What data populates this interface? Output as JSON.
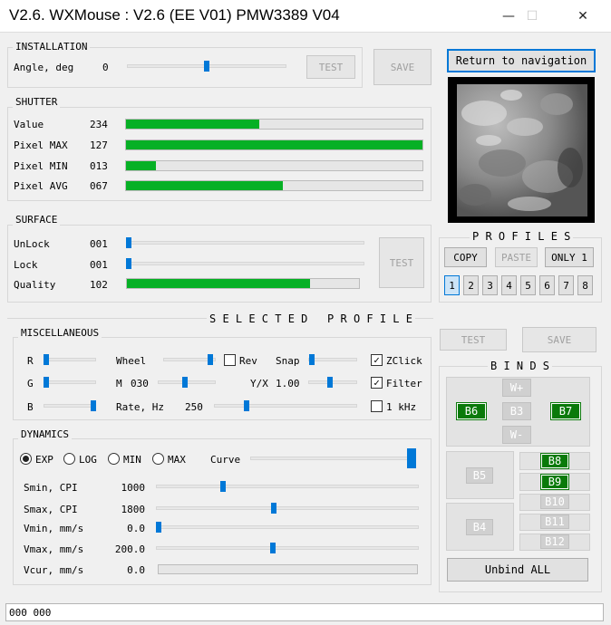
{
  "window": {
    "title": "V2.6. WXMouse : V2.6 (EE V01) PMW3389 V04",
    "minimize_glyph": "—",
    "maximize_glyph": "☐",
    "close_glyph": "✕"
  },
  "installation": {
    "title": "INSTALLATION",
    "angle_label": "Angle, deg",
    "angle_value": "0",
    "test_label": "TEST",
    "save_label": "SAVE"
  },
  "nav": {
    "return_label": "Return to navigation"
  },
  "shutter": {
    "title": "SHUTTER",
    "rows": [
      {
        "label": "Value",
        "value": "234",
        "fill": 0.45
      },
      {
        "label": "Pixel MAX",
        "value": "127",
        "fill": 1.0
      },
      {
        "label": "Pixel MIN",
        "value": "013",
        "fill": 0.1
      },
      {
        "label": "Pixel AVG",
        "value": "067",
        "fill": 0.53
      }
    ]
  },
  "surface": {
    "title": "SURFACE",
    "unlock_label": "UnLock",
    "unlock_value": "001",
    "lock_label": "Lock",
    "lock_value": "001",
    "quality_label": "Quality",
    "quality_value": "102",
    "quality_fill": 0.79,
    "test_label": "TEST"
  },
  "profiles": {
    "title": "P R O F I L E S",
    "copy_label": "COPY",
    "paste_label": "PASTE",
    "only1_label": "ONLY 1",
    "numbers": [
      "1",
      "2",
      "3",
      "4",
      "5",
      "6",
      "7",
      "8"
    ],
    "selected": "1"
  },
  "selected_profile": {
    "title": "S E L E C T E D   P R O F I L E",
    "test_label": "TEST",
    "save_label": "SAVE"
  },
  "misc": {
    "title": "MISCELLANEOUS",
    "r_label": "R",
    "g_label": "G",
    "b_label": "B",
    "wheel_label": "Wheel",
    "rev_label": "Rev",
    "snap_label": "Snap",
    "zclick_label": "ZClick",
    "m_label": "M",
    "m_value": "030",
    "yx_label": "Y/X",
    "yx_value": "1.00",
    "filter_label": "Filter",
    "rate_label": "Rate, Hz",
    "rate_value": "250",
    "khz_label": "1 kHz",
    "check_glyph": "✓"
  },
  "dynamics": {
    "title": "DYNAMICS",
    "modes": [
      "EXP",
      "LOG",
      "MIN",
      "MAX"
    ],
    "selected_mode": "EXP",
    "curve_label": "Curve",
    "rows": [
      {
        "label": "Smin, CPI",
        "value": "1000"
      },
      {
        "label": "Smax, CPI",
        "value": "1800"
      },
      {
        "label": "Vmin, mm/s",
        "value": "0.0"
      },
      {
        "label": "Vmax, mm/s",
        "value": "200.0"
      },
      {
        "label": "Vcur, mm/s",
        "value": "0.0"
      }
    ]
  },
  "binds": {
    "title": "B I N D S",
    "keys": {
      "w_plus": "W+",
      "b3": "B3",
      "w_minus": "W-",
      "b6": "B6",
      "b7": "B7",
      "b5": "B5",
      "b4": "B4",
      "b8": "B8",
      "b9": "B9",
      "b10": "B10",
      "b11": "B11",
      "b12": "B12"
    },
    "unbind_label": "Unbind ALL"
  },
  "status": {
    "text": "000 000"
  }
}
